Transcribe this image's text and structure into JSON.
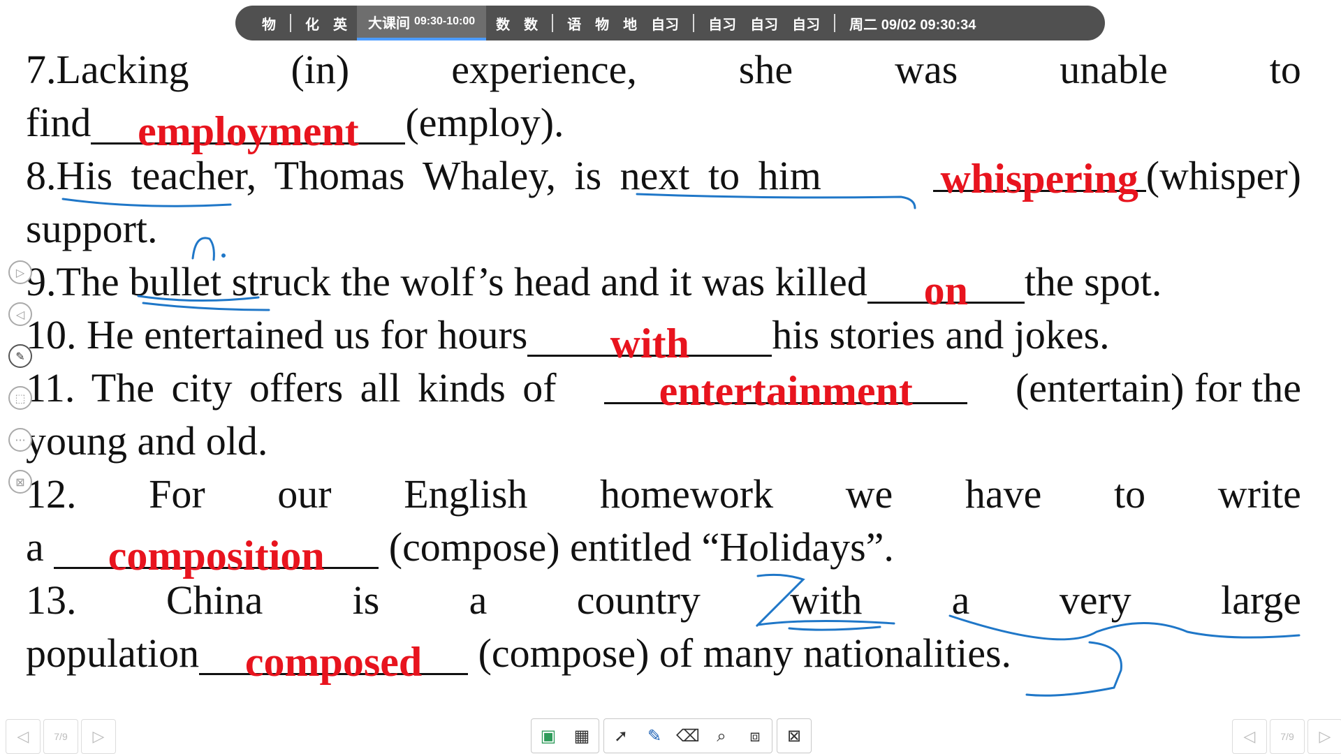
{
  "schedule": {
    "items_a": [
      "物",
      "化",
      "英"
    ],
    "current_label": "大课间",
    "current_time": "09:30-10:00",
    "items_b": [
      "数",
      "数"
    ],
    "items_c": [
      "语",
      "物",
      "地",
      "自习"
    ],
    "items_d": [
      "自习",
      "自习",
      "自习"
    ],
    "clock": "周二 09/02  09:30:34"
  },
  "exercises": {
    "q7": {
      "line1": [
        "7.Lacking",
        "(in)",
        "experience,",
        "she",
        "was",
        "unable",
        "to"
      ],
      "before": "find",
      "answer": "employment",
      "after": "(employ)."
    },
    "q8": {
      "line1_before": "8.His teacher, Thomas Whaley, is next to him",
      "answer": "whispering",
      "line1_after": "(whisper)",
      "line2": "support."
    },
    "q9": {
      "before": "9.The bullet struck the wolf’s head and it was killed",
      "answer": "on",
      "after": "the spot."
    },
    "q10": {
      "before": "10. He entertained us for hours",
      "answer": "with",
      "after": "his stories and jokes."
    },
    "q11": {
      "before": "11. The city offers all kinds of",
      "answer": "entertainment",
      "after": "(entertain) for the",
      "line2": "young and old."
    },
    "q12": {
      "line1": [
        "12.",
        "For",
        "our",
        "English",
        "homework",
        "we",
        "have",
        "to",
        "write"
      ],
      "before": "a",
      "answer": "composition",
      "after": "(compose) entitled “Holidays”."
    },
    "q13": {
      "line1": [
        "13.",
        "China",
        "is",
        "a",
        "country",
        "with",
        "a",
        "very",
        "large"
      ],
      "before": "population",
      "answer": "composed",
      "after": "(compose) of many nationalities."
    }
  },
  "pager": {
    "left_label": "7/9",
    "right_label": "7/9"
  },
  "colors": {
    "answer": "#e8141e",
    "ink": "#1f77c8",
    "bar": "#505050"
  }
}
